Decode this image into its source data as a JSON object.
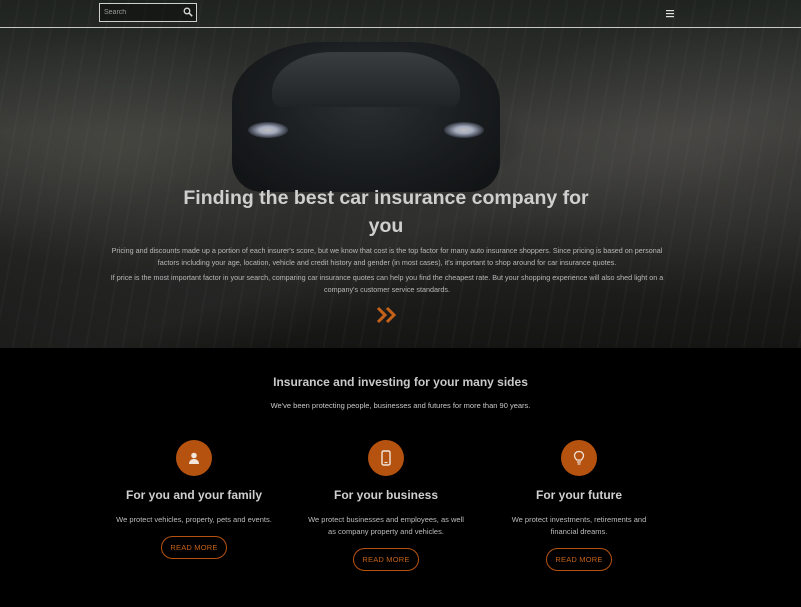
{
  "search": {
    "placeholder": "Search"
  },
  "nav": {
    "menu_icon": "hamburger-menu-icon"
  },
  "hero": {
    "title": "Finding the best car insurance company for you",
    "paragraph_1": "Pricing and discounts made up a portion of each insurer's score, but we know that cost is the top factor for many auto insurance shoppers. Since pricing is based on personal factors including your age, location, vehicle and credit history and gender (in most cases), it's important to shop around for car insurance quotes.",
    "paragraph_2": "If price is the most important factor in your search, comparing car insurance quotes can help you find the cheapest rate. But your shopping experience will also shed light on a company's customer service standards.",
    "scroll_icon": "double-chevron-right-icon"
  },
  "features": {
    "title": "Insurance and investing for your many sides",
    "subtitle": "We've been protecting people, businesses and futures for more than 90 years.",
    "cards": [
      {
        "icon": "user-icon",
        "title": "For you and your family",
        "text": "We protect vehicles, property, pets and events.",
        "button": "READ MORE"
      },
      {
        "icon": "mobile-phone-icon",
        "title": "For your business",
        "text": "We protect businesses and employees, as well as company property and vehicles.",
        "button": "READ MORE"
      },
      {
        "icon": "lightbulb-icon",
        "title": "For your future",
        "text": "We protect investments, retirements and financial dreams.",
        "button": "READ MORE"
      }
    ]
  },
  "colors": {
    "accent": "#b5520f",
    "background": "#000000",
    "text": "#cfcfcf"
  }
}
